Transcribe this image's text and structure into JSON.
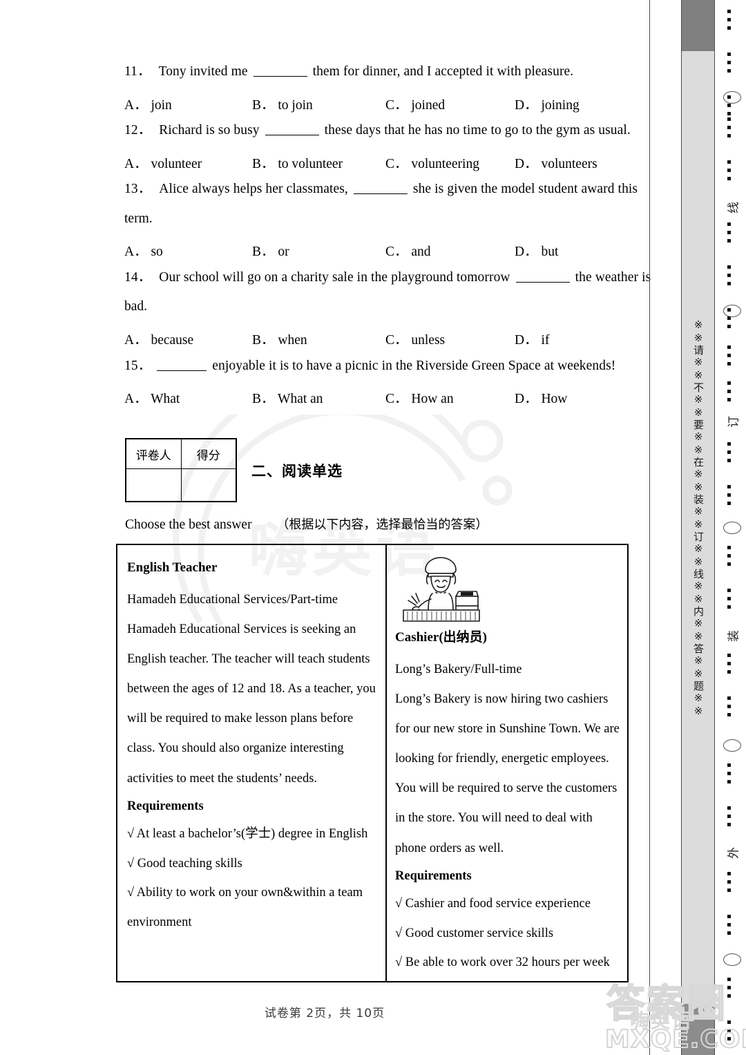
{
  "questions": [
    {
      "number": "11．",
      "text_before": "Tony invited me",
      "text_after": "them for dinner, and I accepted it with pleasure.",
      "continuation": "",
      "options": [
        {
          "label": "A．",
          "text": "join"
        },
        {
          "label": "B．",
          "text": "to join"
        },
        {
          "label": "C．",
          "text": "joined"
        },
        {
          "label": "D．",
          "text": "joining"
        }
      ]
    },
    {
      "number": "12．",
      "text_before": "Richard is so busy",
      "text_after": "these days that he has no time to go to the gym as usual.",
      "continuation": "",
      "options": [
        {
          "label": "A．",
          "text": "volunteer"
        },
        {
          "label": "B．",
          "text": "to volunteer"
        },
        {
          "label": "C．",
          "text": "volunteering"
        },
        {
          "label": "D．",
          "text": "volunteers"
        }
      ]
    },
    {
      "number": "13．",
      "text_before": "Alice always helps her classmates,",
      "text_after": "she is given the model student award this",
      "continuation": "term.",
      "options": [
        {
          "label": "A．",
          "text": "so"
        },
        {
          "label": "B．",
          "text": "or"
        },
        {
          "label": "C．",
          "text": "and"
        },
        {
          "label": "D．",
          "text": "but"
        }
      ]
    },
    {
      "number": "14．",
      "text_before": "Our school will go on a charity sale in the playground tomorrow",
      "text_after": "the weather is",
      "continuation": "bad.",
      "options": [
        {
          "label": "A．",
          "text": "because"
        },
        {
          "label": "B．",
          "text": "when"
        },
        {
          "label": "C．",
          "text": "unless"
        },
        {
          "label": "D．",
          "text": "if"
        }
      ]
    },
    {
      "number": "15．",
      "text_before": "",
      "text_after": "enjoyable it is to have a picnic in the Riverside Green Space at weekends!",
      "continuation": "",
      "options": [
        {
          "label": "A．",
          "text": "What"
        },
        {
          "label": "B．",
          "text": "What an"
        },
        {
          "label": "C．",
          "text": "How an"
        },
        {
          "label": "D．",
          "text": "How"
        }
      ]
    }
  ],
  "score_table": {
    "grader_label": "评卷人",
    "score_label": "得分"
  },
  "section": {
    "title": "二、阅读单选",
    "instruction_en": "Choose the best answer",
    "instruction_cn": "（根据以下内容，选择最恰当的答案）"
  },
  "ads": {
    "left": {
      "heading": "English Teacher",
      "subtitle": "Hamadeh Educational Services/Part-time",
      "body": "Hamadeh Educational Services is seeking an English teacher. The teacher will teach students between the ages of 12 and 18. As a teacher, you will be required to make lesson plans before class. You should also organize interesting activities to meet the students’ needs.",
      "requirements_label": "Requirements",
      "requirements": [
        "√ At least a bachelor’s(学士) degree in English",
        "√ Good teaching skills",
        "√ Ability to work on your own&within a team environment"
      ]
    },
    "right": {
      "heading": "Cashier(出纳员)",
      "subtitle": "Long’s Bakery/Full-time",
      "body": "Long’s Bakery is now hiring two cashiers for our new store in Sunshine Town. We are looking for friendly, energetic employees. You will be required to serve the customers in the store. You will need to deal with phone orders as well.",
      "requirements_label": "Requirements",
      "requirements": [
        "√ Cashier and food service experience",
        "√ Good customer service skills",
        "√ Be able to work over 32 hours per week"
      ],
      "illustration_name": "cashier-illustration"
    }
  },
  "margin": {
    "vertical_warning": "※※请※※不※※要※※在※※装※※订※※线※※内※※答※※题※※",
    "binding_marks": [
      "线",
      "订",
      "装",
      "外"
    ]
  },
  "footer": {
    "text": "试卷第 2页，共 10页"
  },
  "watermarks": {
    "center": "嗨英语",
    "bottom_top": "答案圈",
    "bottom_mid": "嗨英语",
    "bottom_bottom": "MXQE.COM"
  },
  "colors": {
    "ink": "#000000",
    "band_dark": "#808080",
    "band_light": "#dcdcdc",
    "rule": "#4a4a4a",
    "watermark": "#f0f0f0"
  }
}
